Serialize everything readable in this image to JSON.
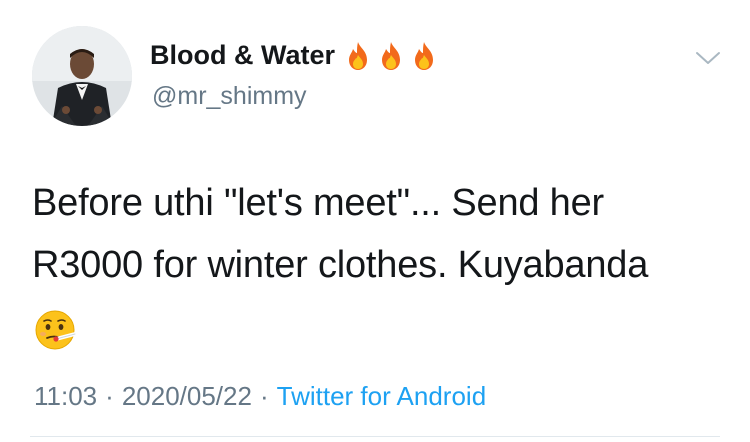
{
  "user": {
    "display_name": "Blood & Water",
    "name_emojis": [
      "fire-icon",
      "fire-icon",
      "fire-icon"
    ],
    "handle": "@mr_shimmy"
  },
  "tweet": {
    "lines": [
      "Before uthi \"let's meet\"... Send her",
      "R3000 for winter clothes. Kuyabanda"
    ],
    "trailing_emoji": "face-with-thermometer-icon"
  },
  "meta": {
    "time": "11:03",
    "separator": "·",
    "date": "2020/05/22",
    "source": "Twitter for Android"
  },
  "colors": {
    "text": "#14171a",
    "secondary": "#657786",
    "link": "#1da1f2",
    "divider": "#e1e8ed"
  }
}
